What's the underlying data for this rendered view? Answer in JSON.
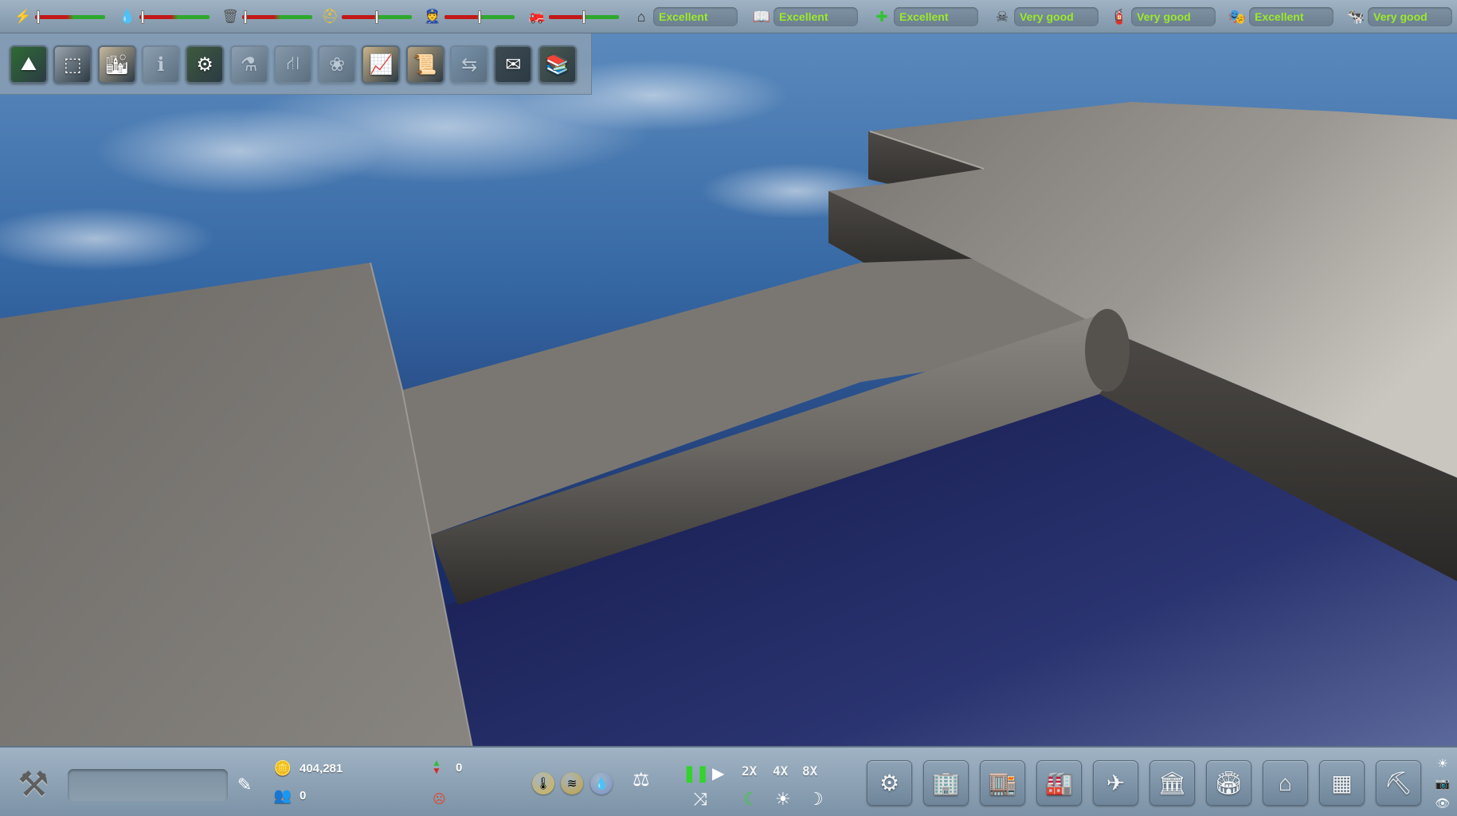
{
  "top_bar": {
    "meters": [
      {
        "name": "electricity",
        "icon": "lightning-icon",
        "glyph": "⚡",
        "color": "#f2c21b",
        "level": 0.02
      },
      {
        "name": "water",
        "icon": "water-drop-icon",
        "glyph": "💧",
        "color": "#3a8ee6",
        "level": 0.02
      },
      {
        "name": "garbage",
        "icon": "garbage-bag-icon",
        "glyph": "🗑",
        "color": "#555555",
        "level": 0.02
      },
      {
        "name": "workers",
        "icon": "worker-helmet-icon",
        "glyph": "⛑",
        "color": "#f5c518",
        "level": 0.5
      },
      {
        "name": "police",
        "icon": "police-icon",
        "glyph": "👮",
        "color": "#3a60c0",
        "level": 0.5
      },
      {
        "name": "fire",
        "icon": "firefighter-icon",
        "glyph": "🚒",
        "color": "#b44",
        "level": 0.5
      }
    ],
    "ratings": [
      {
        "name": "housing",
        "icon": "house-icon",
        "glyph": "⌂",
        "value": "Excellent"
      },
      {
        "name": "education",
        "icon": "book-icon",
        "glyph": "📖",
        "value": "Excellent"
      },
      {
        "name": "health",
        "icon": "health-cross-icon",
        "glyph": "✚",
        "value": "Excellent"
      },
      {
        "name": "pollution",
        "icon": "skull-icon",
        "glyph": "☠",
        "value": "Very good"
      },
      {
        "name": "fire-safety",
        "icon": "fire-hydrant-icon",
        "glyph": "🧯",
        "value": "Very good"
      },
      {
        "name": "entertainment",
        "icon": "theater-masks-icon",
        "glyph": "🎭",
        "value": "Excellent"
      },
      {
        "name": "livestock",
        "icon": "cow-icon",
        "glyph": "🐄",
        "value": "Very good"
      }
    ]
  },
  "tool_panel": {
    "tools": [
      {
        "name": "terrain-tool",
        "icon": "terrain-icon",
        "glyph": "⛰",
        "bg": "#2e6b34",
        "enabled": true
      },
      {
        "name": "blocks-tool",
        "icon": "blocks-icon",
        "glyph": "⬚",
        "bg": "#9aa4ad",
        "enabled": true
      },
      {
        "name": "city-tool",
        "icon": "skyline-icon",
        "glyph": "🏙",
        "bg": "#c8b89e",
        "enabled": true
      },
      {
        "name": "info-tool",
        "icon": "info-icon",
        "glyph": "ℹ",
        "bg": "#9aa4ad",
        "enabled": false
      },
      {
        "name": "services-tool",
        "icon": "services-icon",
        "glyph": "⚙",
        "bg": "#3d5a3e",
        "enabled": true
      },
      {
        "name": "research-tool",
        "icon": "flask-icon",
        "glyph": "⚗",
        "bg": "#9aa4ad",
        "enabled": false
      },
      {
        "name": "roads-tool",
        "icon": "road-icon",
        "glyph": "⛙",
        "bg": "#8a96a0",
        "enabled": false
      },
      {
        "name": "nature-tool",
        "icon": "tree-icon",
        "glyph": "❀",
        "bg": "#8a96a0",
        "enabled": false
      },
      {
        "name": "charts-tool",
        "icon": "chart-icon",
        "glyph": "📈",
        "bg": "#cbb48a",
        "enabled": true
      },
      {
        "name": "documents-tool",
        "icon": "document-icon",
        "glyph": "📜",
        "bg": "#b9a583",
        "enabled": true
      },
      {
        "name": "transit-tool",
        "icon": "transit-icon",
        "glyph": "⇆",
        "bg": "#6f8aa0",
        "enabled": false
      },
      {
        "name": "mail-tool",
        "icon": "envelope-icon",
        "glyph": "✉",
        "bg": "#3d4a52",
        "enabled": true
      },
      {
        "name": "library-tool",
        "icon": "library-icon",
        "glyph": "📚",
        "bg": "#4a5a50",
        "enabled": true
      }
    ]
  },
  "bottom_bar": {
    "wrench_icon": "tools-icon",
    "city_name_value": "",
    "edit_icon": "edit-pencil-icon",
    "money": "404,281",
    "money_icon": "coins-icon",
    "population": "0",
    "population_icon": "people-icon",
    "population_change": "0",
    "trend_icon": "up-down-arrows-icon",
    "mood_icon": "sad-face-icon",
    "overlays": [
      {
        "name": "temperature-overlay",
        "icon": "thermometer-icon",
        "glyph": "🌡",
        "bg": "#d8b54a"
      },
      {
        "name": "wind-overlay",
        "icon": "wind-icon",
        "glyph": "≋",
        "bg": "#c9a43a"
      },
      {
        "name": "water-overlay",
        "icon": "water-drop-icon",
        "glyph": "💧",
        "bg": "#7c93c8"
      }
    ],
    "budget_icon": "scales-icon",
    "speed": {
      "pause_icon": "pause-icon",
      "play_icon": "play-icon",
      "speed_2x": "2X",
      "speed_4x": "4X",
      "speed_8x": "8X",
      "shuffle_icon": "shuffle-icon",
      "day_night_icon": "day-night-icon",
      "day_icon": "sun-icon",
      "night_icon": "moon-icon"
    },
    "zones": [
      {
        "name": "utilities-zone",
        "icon": "wind-turbine-icon",
        "glyph": "⚙"
      },
      {
        "name": "residential-zone",
        "icon": "apartment-icon",
        "glyph": "🏢"
      },
      {
        "name": "commercial-zone",
        "icon": "office-icon",
        "glyph": "🏬"
      },
      {
        "name": "industrial-zone",
        "icon": "factory-icon",
        "glyph": "🏭"
      },
      {
        "name": "airport-zone",
        "icon": "airplane-icon",
        "glyph": "✈"
      },
      {
        "name": "government-zone",
        "icon": "capitol-icon",
        "glyph": "🏛"
      },
      {
        "name": "landmark-zone",
        "icon": "stadium-icon",
        "glyph": "🏟"
      },
      {
        "name": "greenhouse-zone",
        "icon": "greenhouse-icon",
        "glyph": "⌂"
      },
      {
        "name": "storage-zone",
        "icon": "containers-icon",
        "glyph": "▦"
      },
      {
        "name": "demolish-zone",
        "icon": "excavator-icon",
        "glyph": "⛏"
      }
    ],
    "side_icons": [
      {
        "name": "weather-icon",
        "glyph": "☀"
      },
      {
        "name": "camera-icon",
        "glyph": "📷"
      },
      {
        "name": "eye-icon",
        "glyph": "👁"
      }
    ]
  },
  "colors": {
    "rating_text": "#9bea2b",
    "accent_green": "#32d42b",
    "water_deep": "#16204a",
    "concrete": "#7b7874"
  }
}
